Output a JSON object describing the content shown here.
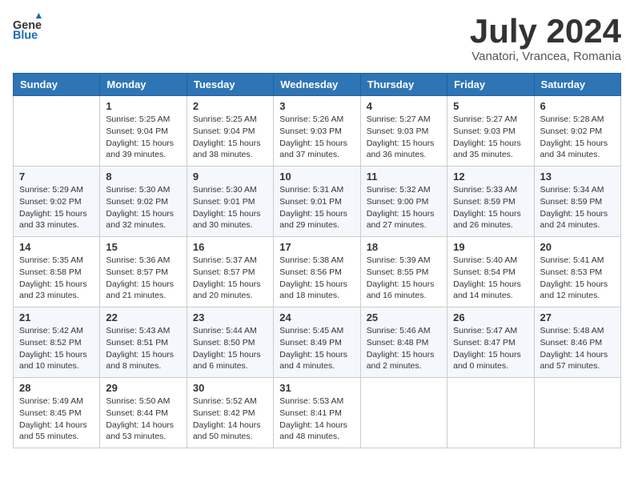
{
  "header": {
    "logo_line1": "General",
    "logo_line2": "Blue",
    "month": "July 2024",
    "location": "Vanatori, Vrancea, Romania"
  },
  "weekdays": [
    "Sunday",
    "Monday",
    "Tuesday",
    "Wednesday",
    "Thursday",
    "Friday",
    "Saturday"
  ],
  "weeks": [
    [
      {
        "day": "",
        "info": ""
      },
      {
        "day": "1",
        "info": "Sunrise: 5:25 AM\nSunset: 9:04 PM\nDaylight: 15 hours\nand 39 minutes."
      },
      {
        "day": "2",
        "info": "Sunrise: 5:25 AM\nSunset: 9:04 PM\nDaylight: 15 hours\nand 38 minutes."
      },
      {
        "day": "3",
        "info": "Sunrise: 5:26 AM\nSunset: 9:03 PM\nDaylight: 15 hours\nand 37 minutes."
      },
      {
        "day": "4",
        "info": "Sunrise: 5:27 AM\nSunset: 9:03 PM\nDaylight: 15 hours\nand 36 minutes."
      },
      {
        "day": "5",
        "info": "Sunrise: 5:27 AM\nSunset: 9:03 PM\nDaylight: 15 hours\nand 35 minutes."
      },
      {
        "day": "6",
        "info": "Sunrise: 5:28 AM\nSunset: 9:02 PM\nDaylight: 15 hours\nand 34 minutes."
      }
    ],
    [
      {
        "day": "7",
        "info": "Sunrise: 5:29 AM\nSunset: 9:02 PM\nDaylight: 15 hours\nand 33 minutes."
      },
      {
        "day": "8",
        "info": "Sunrise: 5:30 AM\nSunset: 9:02 PM\nDaylight: 15 hours\nand 32 minutes."
      },
      {
        "day": "9",
        "info": "Sunrise: 5:30 AM\nSunset: 9:01 PM\nDaylight: 15 hours\nand 30 minutes."
      },
      {
        "day": "10",
        "info": "Sunrise: 5:31 AM\nSunset: 9:01 PM\nDaylight: 15 hours\nand 29 minutes."
      },
      {
        "day": "11",
        "info": "Sunrise: 5:32 AM\nSunset: 9:00 PM\nDaylight: 15 hours\nand 27 minutes."
      },
      {
        "day": "12",
        "info": "Sunrise: 5:33 AM\nSunset: 8:59 PM\nDaylight: 15 hours\nand 26 minutes."
      },
      {
        "day": "13",
        "info": "Sunrise: 5:34 AM\nSunset: 8:59 PM\nDaylight: 15 hours\nand 24 minutes."
      }
    ],
    [
      {
        "day": "14",
        "info": "Sunrise: 5:35 AM\nSunset: 8:58 PM\nDaylight: 15 hours\nand 23 minutes."
      },
      {
        "day": "15",
        "info": "Sunrise: 5:36 AM\nSunset: 8:57 PM\nDaylight: 15 hours\nand 21 minutes."
      },
      {
        "day": "16",
        "info": "Sunrise: 5:37 AM\nSunset: 8:57 PM\nDaylight: 15 hours\nand 20 minutes."
      },
      {
        "day": "17",
        "info": "Sunrise: 5:38 AM\nSunset: 8:56 PM\nDaylight: 15 hours\nand 18 minutes."
      },
      {
        "day": "18",
        "info": "Sunrise: 5:39 AM\nSunset: 8:55 PM\nDaylight: 15 hours\nand 16 minutes."
      },
      {
        "day": "19",
        "info": "Sunrise: 5:40 AM\nSunset: 8:54 PM\nDaylight: 15 hours\nand 14 minutes."
      },
      {
        "day": "20",
        "info": "Sunrise: 5:41 AM\nSunset: 8:53 PM\nDaylight: 15 hours\nand 12 minutes."
      }
    ],
    [
      {
        "day": "21",
        "info": "Sunrise: 5:42 AM\nSunset: 8:52 PM\nDaylight: 15 hours\nand 10 minutes."
      },
      {
        "day": "22",
        "info": "Sunrise: 5:43 AM\nSunset: 8:51 PM\nDaylight: 15 hours\nand 8 minutes."
      },
      {
        "day": "23",
        "info": "Sunrise: 5:44 AM\nSunset: 8:50 PM\nDaylight: 15 hours\nand 6 minutes."
      },
      {
        "day": "24",
        "info": "Sunrise: 5:45 AM\nSunset: 8:49 PM\nDaylight: 15 hours\nand 4 minutes."
      },
      {
        "day": "25",
        "info": "Sunrise: 5:46 AM\nSunset: 8:48 PM\nDaylight: 15 hours\nand 2 minutes."
      },
      {
        "day": "26",
        "info": "Sunrise: 5:47 AM\nSunset: 8:47 PM\nDaylight: 15 hours\nand 0 minutes."
      },
      {
        "day": "27",
        "info": "Sunrise: 5:48 AM\nSunset: 8:46 PM\nDaylight: 14 hours\nand 57 minutes."
      }
    ],
    [
      {
        "day": "28",
        "info": "Sunrise: 5:49 AM\nSunset: 8:45 PM\nDaylight: 14 hours\nand 55 minutes."
      },
      {
        "day": "29",
        "info": "Sunrise: 5:50 AM\nSunset: 8:44 PM\nDaylight: 14 hours\nand 53 minutes."
      },
      {
        "day": "30",
        "info": "Sunrise: 5:52 AM\nSunset: 8:42 PM\nDaylight: 14 hours\nand 50 minutes."
      },
      {
        "day": "31",
        "info": "Sunrise: 5:53 AM\nSunset: 8:41 PM\nDaylight: 14 hours\nand 48 minutes."
      },
      {
        "day": "",
        "info": ""
      },
      {
        "day": "",
        "info": ""
      },
      {
        "day": "",
        "info": ""
      }
    ]
  ]
}
